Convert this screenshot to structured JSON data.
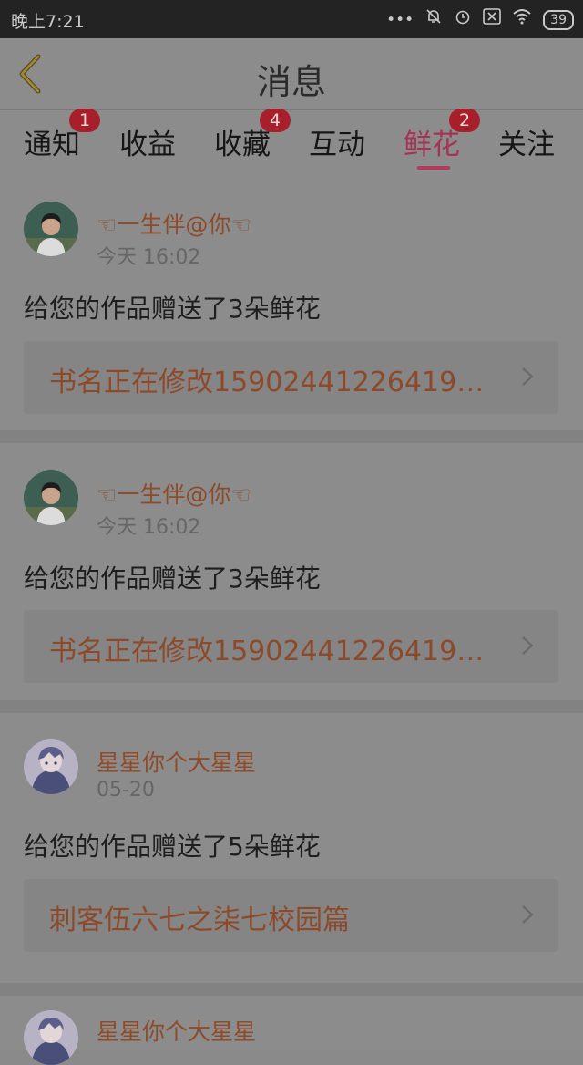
{
  "status_bar": {
    "time": "晚上7:21",
    "dots": "•••",
    "battery": "39"
  },
  "header": {
    "title": "消息"
  },
  "tabs": [
    {
      "label": "通知",
      "badge": "1"
    },
    {
      "label": "收益",
      "badge": ""
    },
    {
      "label": "收藏",
      "badge": "4"
    },
    {
      "label": "互动",
      "badge": ""
    },
    {
      "label": "鲜花",
      "badge": "2",
      "active": true
    },
    {
      "label": "关注",
      "badge": ""
    }
  ],
  "messages": [
    {
      "username": "☜一生伴@你☜",
      "time": "今天 16:02",
      "text": "给您的作品赠送了3朵鲜花",
      "book": "书名正在修改1590244122641​9…",
      "avatar": "boy-avatar"
    },
    {
      "username": "☜一生伴@你☜",
      "time": "今天 16:02",
      "text": "给您的作品赠送了3朵鲜花",
      "book": "书名正在修改1590244122641​9…",
      "avatar": "boy-avatar"
    },
    {
      "username": "星星你个大星星",
      "time": "05-20",
      "text": "给您的作品赠送了5朵鲜花",
      "book": "刺客伍六七之柒七校园篇",
      "avatar": "anime-avatar"
    },
    {
      "username": "星星你个大星星",
      "time": "",
      "text": "",
      "book": "",
      "avatar": "anime-avatar"
    }
  ],
  "colors": {
    "accent": "#b03b5e",
    "badge": "#a81f2c",
    "username": "#8e4b2a"
  }
}
